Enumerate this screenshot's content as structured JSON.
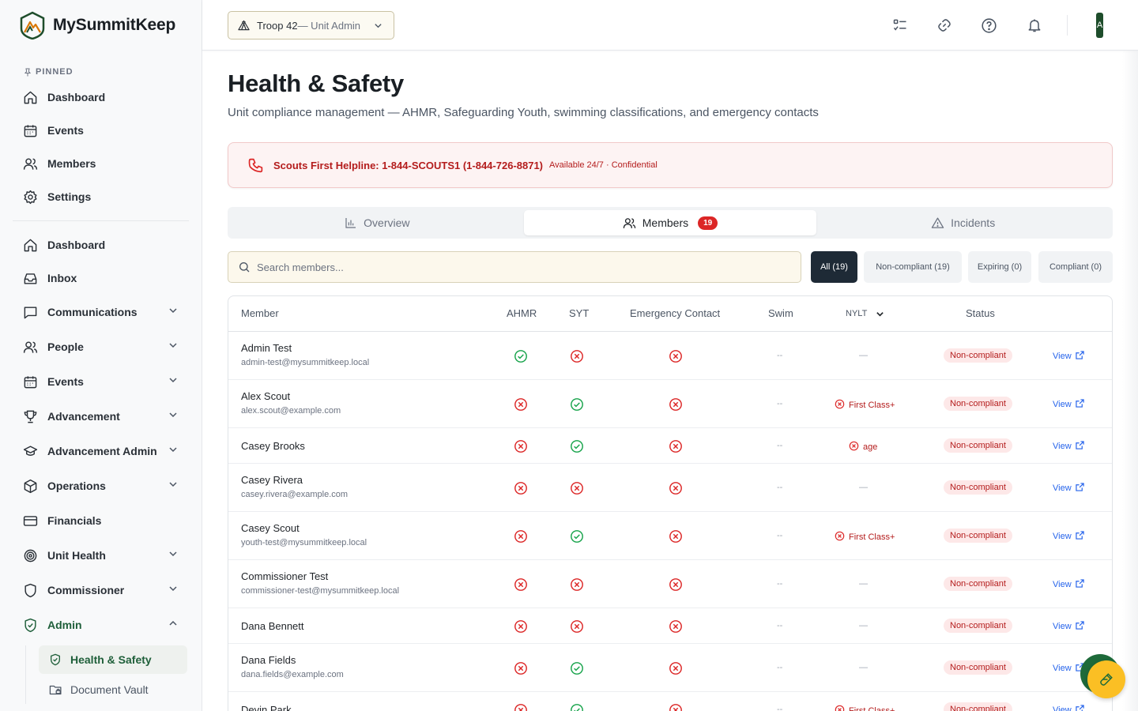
{
  "brand": {
    "name": "MySummitKeep",
    "logo_icon": "mountain-logo-icon"
  },
  "sidebar": {
    "pinned_label": "PINNED",
    "pinned": [
      {
        "label": "Dashboard",
        "icon": "home-icon"
      },
      {
        "label": "Events",
        "icon": "calendar-icon"
      },
      {
        "label": "Members",
        "icon": "users-icon"
      },
      {
        "label": "Settings",
        "icon": "gear-icon"
      }
    ],
    "nav": [
      {
        "label": "Dashboard",
        "icon": "home-icon",
        "expandable": false
      },
      {
        "label": "Inbox",
        "icon": "inbox-icon",
        "expandable": false
      },
      {
        "label": "Communications",
        "icon": "message-icon",
        "expandable": true
      },
      {
        "label": "People",
        "icon": "users-icon",
        "expandable": true
      },
      {
        "label": "Events",
        "icon": "calendar-icon",
        "expandable": true
      },
      {
        "label": "Advancement",
        "icon": "trophy-icon",
        "expandable": true
      },
      {
        "label": "Advancement Admin",
        "icon": "graduation-cap-icon",
        "expandable": true
      },
      {
        "label": "Operations",
        "icon": "box-icon",
        "expandable": true
      },
      {
        "label": "Financials",
        "icon": "credit-card-icon",
        "expandable": false
      },
      {
        "label": "Unit Health",
        "icon": "target-icon",
        "expandable": true
      },
      {
        "label": "Commissioner",
        "icon": "shield-icon",
        "expandable": true
      },
      {
        "label": "Admin",
        "icon": "shield-check-icon",
        "expandable": true,
        "expanded": true
      }
    ],
    "admin_sub": [
      {
        "label": "Health & Safety",
        "icon": "shield-check-icon",
        "active": true
      },
      {
        "label": "Document Vault",
        "icon": "folder-lock-icon",
        "active": false
      }
    ]
  },
  "topbar": {
    "unit_name": "Troop 42",
    "unit_role": " — Unit Admin",
    "avatar_initial": "A"
  },
  "page": {
    "title": "Health & Safety",
    "subtitle": "Unit compliance management — AHMR, Safeguarding Youth, swimming classifications, and emergency contacts"
  },
  "alert": {
    "main": "Scouts First Helpline: 1-844-SCOUTS1 (1-844-726-8871)",
    "sub": "Available 24/7 · Confidential"
  },
  "tabs": [
    {
      "label": "Overview",
      "icon": "bar-chart-icon"
    },
    {
      "label": "Members",
      "icon": "users-icon",
      "badge": "19",
      "active": true
    },
    {
      "label": "Incidents",
      "icon": "warning-icon"
    }
  ],
  "search": {
    "placeholder": "Search members..."
  },
  "filters": [
    {
      "label": "All (19)",
      "active": true
    },
    {
      "label": "Non-compliant (19)",
      "active": false
    },
    {
      "label": "Expiring (0)",
      "active": false
    },
    {
      "label": "Compliant (0)",
      "active": false
    }
  ],
  "table": {
    "headers": {
      "member": "Member",
      "ahmr": "AHMR",
      "syt": "SYT",
      "emergency": "Emergency Contact",
      "swim": "Swim",
      "nylt": "NYLT",
      "status": "Status"
    },
    "rows": [
      {
        "name": "Admin Test",
        "email": "admin-test@mysummitkeep.local",
        "ahmr": "ok",
        "syt": "fail",
        "emergency": "fail",
        "swim": "--",
        "nylt": "—",
        "status": "Non-compliant",
        "action": "View"
      },
      {
        "name": "Alex Scout",
        "email": "alex.scout@example.com",
        "ahmr": "fail",
        "syt": "ok",
        "emergency": "fail",
        "swim": "--",
        "nylt": "First Class+",
        "status": "Non-compliant",
        "action": "View"
      },
      {
        "name": "Casey Brooks",
        "email": "",
        "ahmr": "fail",
        "syt": "ok",
        "emergency": "fail",
        "swim": "--",
        "nylt": "age",
        "status": "Non-compliant",
        "action": "View"
      },
      {
        "name": "Casey Rivera",
        "email": "casey.rivera@example.com",
        "ahmr": "fail",
        "syt": "fail",
        "emergency": "fail",
        "swim": "--",
        "nylt": "—",
        "status": "Non-compliant",
        "action": "View"
      },
      {
        "name": "Casey Scout",
        "email": "youth-test@mysummitkeep.local",
        "ahmr": "fail",
        "syt": "ok",
        "emergency": "fail",
        "swim": "--",
        "nylt": "First Class+",
        "status": "Non-compliant",
        "action": "View"
      },
      {
        "name": "Commissioner Test",
        "email": "commissioner-test@mysummitkeep.local",
        "ahmr": "fail",
        "syt": "fail",
        "emergency": "fail",
        "swim": "--",
        "nylt": "—",
        "status": "Non-compliant",
        "action": "View"
      },
      {
        "name": "Dana Bennett",
        "email": "",
        "ahmr": "fail",
        "syt": "fail",
        "emergency": "fail",
        "swim": "--",
        "nylt": "—",
        "status": "Non-compliant",
        "action": "View"
      },
      {
        "name": "Dana Fields",
        "email": "dana.fields@example.com",
        "ahmr": "fail",
        "syt": "ok",
        "emergency": "fail",
        "swim": "--",
        "nylt": "—",
        "status": "Non-compliant",
        "action": "View"
      },
      {
        "name": "Devin Park",
        "email": "",
        "ahmr": "fail",
        "syt": "ok",
        "emergency": "fail",
        "swim": "--",
        "nylt": "First Class+",
        "status": "Non-compliant",
        "action": "View"
      }
    ]
  },
  "colors": {
    "ok": "#16a34a",
    "fail": "#dc2626",
    "brand_green": "#1e4d2b",
    "accent_yellow": "#fbbf24"
  }
}
